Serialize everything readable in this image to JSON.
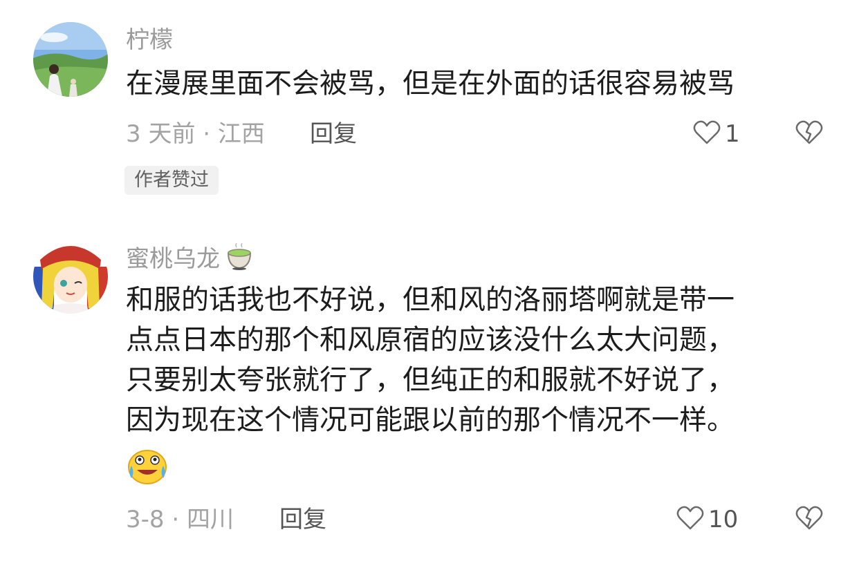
{
  "comments": [
    {
      "username": "柠檬",
      "lines": [
        "在漫展里面不会被骂，但是在外面的话很容易被骂"
      ],
      "meta": "3 天前 · 江西",
      "reply_label": "回复",
      "like_count": "1",
      "badge": "作者赞过"
    },
    {
      "username": "蜜桃乌龙",
      "username_emoji": "tea-icon",
      "lines": [
        "和服的话我也不好说，但和风的洛丽塔啊就是带一",
        "点点日本的那个和风原宿的应该没什么太大问题，",
        "只要别太夸张就行了，但纯正的和服就不好说了，",
        "因为现在这个情况可能跟以前的那个情况不一样。"
      ],
      "body_emoji": "laughing-crying-face-icon",
      "meta": "3-8 · 四川",
      "reply_label": "回复",
      "like_count": "10"
    }
  ]
}
